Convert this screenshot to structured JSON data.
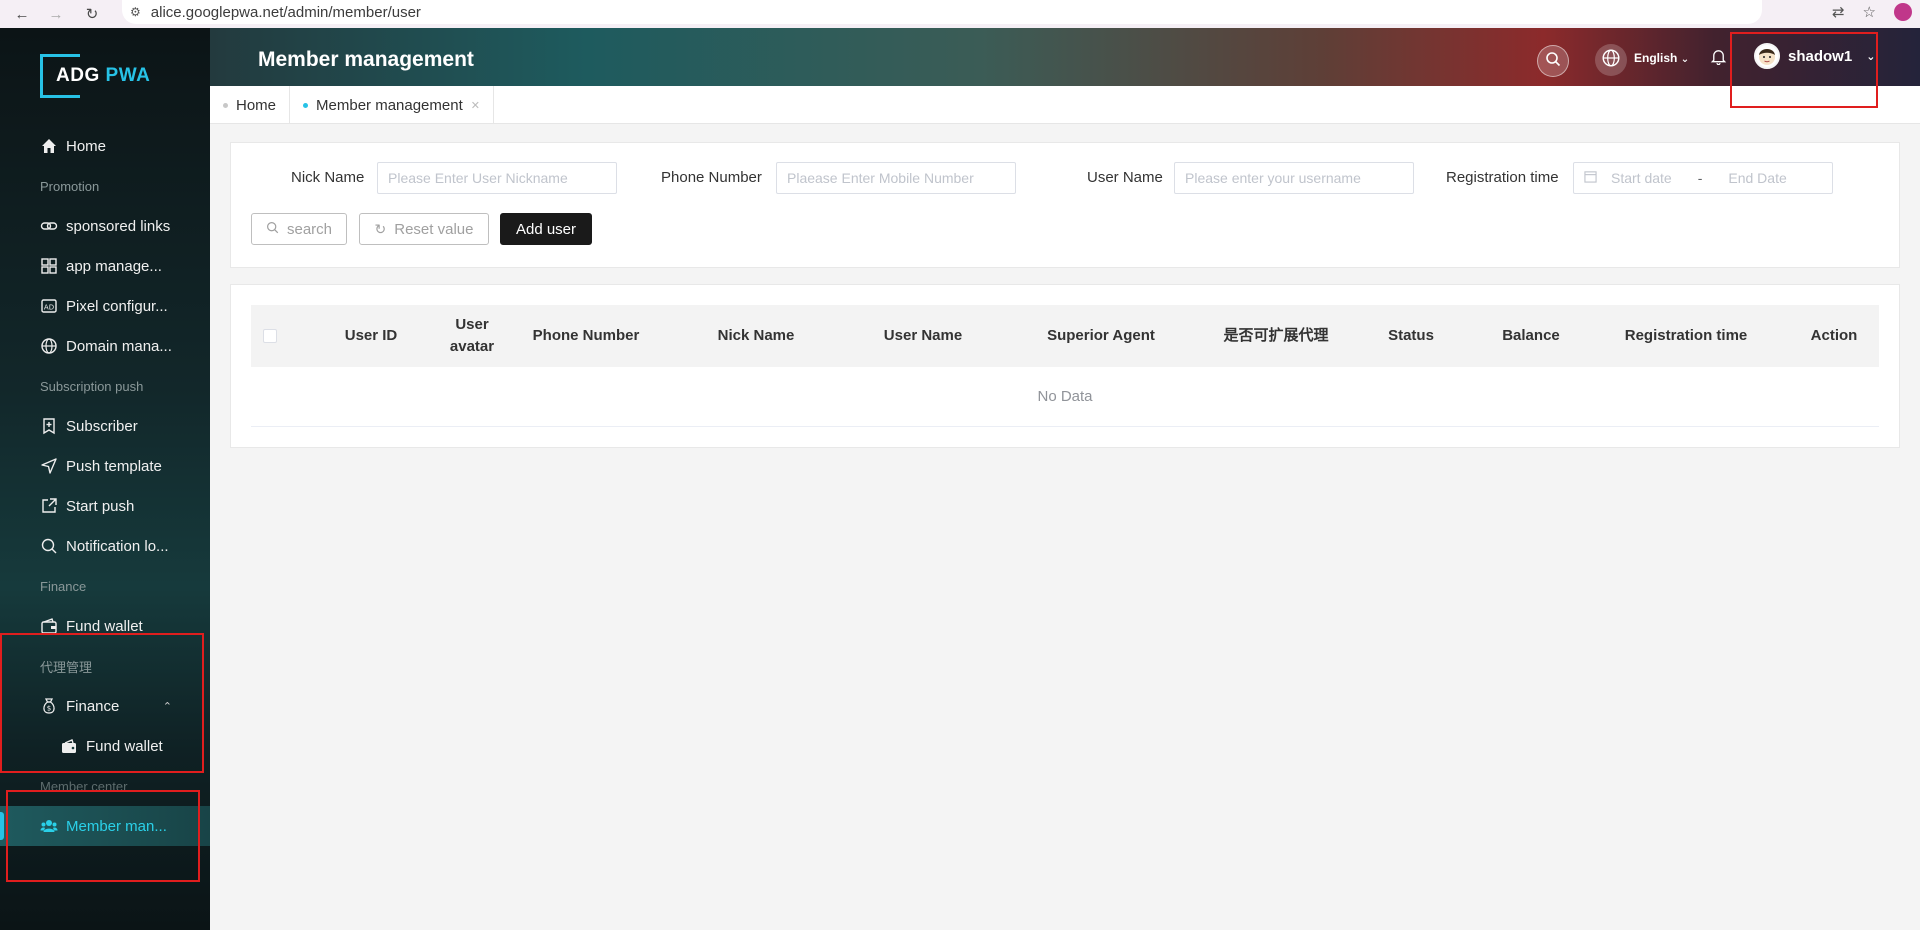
{
  "browser": {
    "url": "alice.googlepwa.net/admin/member/user"
  },
  "brand": {
    "logo_part1": "ADG",
    "logo_part2": "PWA"
  },
  "sidebar": {
    "home": "Home",
    "group_promotion": "Promotion",
    "sponsored_links": "sponsored links",
    "app_management": "app manage...",
    "pixel_config": "Pixel configur...",
    "domain_management": "Domain mana...",
    "group_subscription": "Subscription push",
    "subscriber": "Subscriber",
    "push_template": "Push template",
    "start_push": "Start push",
    "notification_log": "Notification lo...",
    "group_finance": "Finance",
    "fund_wallet": "Fund wallet",
    "group_agent": "代理管理",
    "agent_finance": "Finance",
    "agent_fund_wallet": "Fund wallet",
    "group_member": "Member center",
    "member_management": "Member man..."
  },
  "header": {
    "title": "Member management",
    "language": "English",
    "username": "shadow1"
  },
  "tabs": [
    {
      "label": "Home"
    },
    {
      "label": "Member management"
    }
  ],
  "filters": {
    "nick_label": "Nick Name",
    "nick_placeholder": "Please Enter User Nickname",
    "phone_label": "Phone Number",
    "phone_placeholder": "Plaease Enter Mobile Number",
    "user_label": "User Name",
    "user_placeholder": "Please enter your username",
    "reg_label": "Registration time",
    "start_placeholder": "Start date",
    "date_sep": "-",
    "end_placeholder": "End Date"
  },
  "buttons": {
    "search": "search",
    "reset": "Reset value",
    "add_user": "Add user"
  },
  "table": {
    "columns": [
      "User ID",
      "User avatar",
      "Phone Number",
      "Nick Name",
      "User Name",
      "Superior Agent",
      "是否可扩展代理",
      "Status",
      "Balance",
      "Registration time",
      "Action"
    ],
    "empty_text": "No Data"
  },
  "colors": {
    "accent": "#27c2e6",
    "annotation": "#e01e1e",
    "primary_button": "#1a1a1a"
  }
}
